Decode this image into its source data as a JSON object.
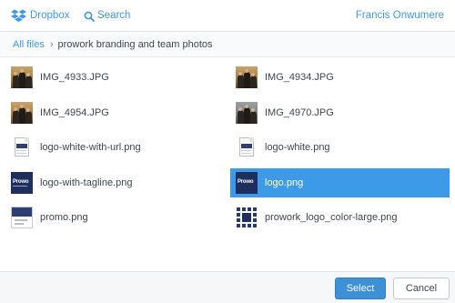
{
  "header": {
    "brand_label": "Dropbox",
    "search_label": "Search",
    "user_name": "Francis Onwumere"
  },
  "breadcrumb": {
    "root": "All files",
    "separator": "›",
    "current": "prowork branding and team photos"
  },
  "files": [
    {
      "name": "IMG_4933.JPG",
      "thumb": "photo-thumbnail",
      "selected": false
    },
    {
      "name": "IMG_4934.JPG",
      "thumb": "photo-thumbnail",
      "selected": false
    },
    {
      "name": "IMG_4954.JPG",
      "thumb": "photo-thumbnail",
      "selected": false
    },
    {
      "name": "IMG_4970.JPG",
      "thumb": "photo-thumbnail",
      "selected": false
    },
    {
      "name": "logo-white-with-url.png",
      "thumb": "document-thumbnail",
      "selected": false
    },
    {
      "name": "logo-white.png",
      "thumb": "document-thumbnail",
      "selected": false
    },
    {
      "name": "logo-with-tagline.png",
      "thumb": "logo-thumbnail",
      "selected": false
    },
    {
      "name": "logo.png",
      "thumb": "logo-thumbnail",
      "selected": true
    },
    {
      "name": "promo.png",
      "thumb": "promo-thumbnail",
      "selected": false
    },
    {
      "name": "prowork_logo_color-large.png",
      "thumb": "pattern-logo-thumbnail",
      "selected": false
    }
  ],
  "footer": {
    "select_label": "Select",
    "cancel_label": "Cancel"
  },
  "colors": {
    "accent": "#3d9ae8",
    "selected_row": "#3d9ae8",
    "select_button": "#3d8fd6",
    "logo_navy": "#1e2e5e"
  },
  "icons": {
    "brand": "dropbox-icon",
    "search": "search-icon"
  }
}
